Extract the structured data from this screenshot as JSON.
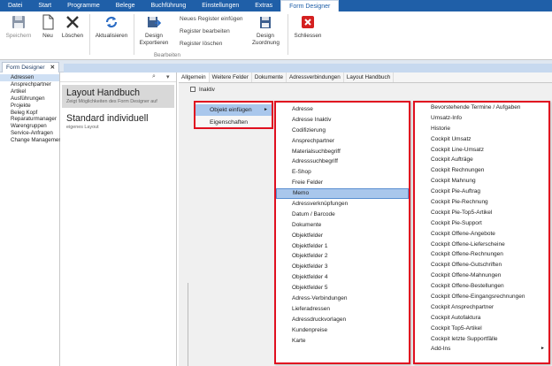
{
  "menubar": {
    "items": [
      "Datei",
      "Start",
      "Programme",
      "Belege",
      "Buchführung",
      "Einstellungen",
      "Extras",
      "Form Designer"
    ],
    "active_index": 7
  },
  "ribbon": {
    "speichern": "Speichern",
    "neu": "Neu",
    "loeschen": "Löschen",
    "aktualisieren": "Aktualisieren",
    "design_exportieren": "Design Exportieren",
    "neues_register": "Neues Register einfügen",
    "register_bearbeiten": "Register bearbeiten",
    "register_loeschen": "Register löschen",
    "design_zuordnung": "Design Zuordnung",
    "schliessen": "Schliessen",
    "group_bearbeiten": "Bearbeiten"
  },
  "doc_tab": {
    "label": "Form Designer",
    "close": "✕"
  },
  "nav": {
    "items": [
      "Adressen",
      "Ansprechpartner",
      "Artikel",
      "Ausführungen",
      "Projekte",
      "Beleg Kopf",
      "Reparaturmanager",
      "Warengruppen",
      "Service-Anfragen",
      "Change Management"
    ],
    "selected_index": 0
  },
  "layouts": [
    {
      "title": "Layout Handbuch",
      "subtitle": "Zeigt Möglichkeiten des Form Designer auf",
      "selected": true
    },
    {
      "title": "Standard individuell",
      "subtitle": "eigenes Layout",
      "selected": false
    }
  ],
  "designer": {
    "tabs": [
      "Allgemein",
      "Weitere Felder",
      "Dokumente",
      "Adressverbindungen",
      "Layout Handbuch"
    ],
    "active_tab": 0,
    "inaktiv_label": "Inaktiv"
  },
  "context_menu": {
    "items": [
      "Objekt einfügen",
      "Eigenschaften"
    ],
    "highlight_index": 0,
    "submenu_arrow": "►"
  },
  "submenu": {
    "items": [
      "Adresse",
      "Adresse Inaktiv",
      "Codifizierung",
      "Ansprechpartner",
      "Materialsuchbegriff",
      "Adresssuchbegriff",
      "E-Shop",
      "Freie Felder",
      "Memo",
      "Adressverknüpfungen",
      "Datum / Barcode",
      "Dokumente",
      "Objektfelder",
      "Objektfelder 1",
      "Objektfelder 2",
      "Objektfelder 3",
      "Objektfelder 4",
      "Objektfelder 5",
      "Adress-Verbindungen",
      "Lieferadressen",
      "Adressdruckvorlagen",
      "Kundenpreise",
      "Karte"
    ],
    "highlight_index": 8
  },
  "submenu2": {
    "items": [
      "Bevorstehende Termine / Aufgaben",
      "Umsatz-Info",
      "Historie",
      "Cockpit Umsatz",
      "Cockpit Line-Umsatz",
      "Cockpit Aufträge",
      "Cockpit Rechnungen",
      "Cockpit Mahnung",
      "Cockpit Pie-Auftrag",
      "Cockpit Pie-Rechnung",
      "Cockpit Pie-Top5-Artikel",
      "Cockpit Pie-Support",
      "Cockpit Offene-Angebote",
      "Cockpit Offene-Lieferscheine",
      "Cockpit Offene-Rechnungen",
      "Cockpit Offene-Gutschriften",
      "Cockpit Offene-Mahnungen",
      "Cockpit Offene-Bestellungen",
      "Cockpit Offene-Eingangsrechnungen",
      "Cockpit Ansprechpartner",
      "Cockpit Autofaktura",
      "Cockpit Top5-Artikel",
      "Cockpit letzte Supportfälle",
      "Add-Ins"
    ],
    "last_has_arrow": true
  },
  "colors": {
    "menubar": "#1f5fa8",
    "highlight": "#a9c7ec",
    "frame": "#e01020"
  },
  "icons": [
    "save-icon",
    "new-document-icon",
    "delete-x-icon",
    "refresh-icon",
    "export-design-icon",
    "design-assign-icon",
    "close-red-icon",
    "search-icon",
    "dropdown-icon"
  ]
}
